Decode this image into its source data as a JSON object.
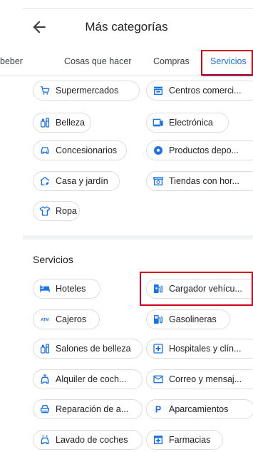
{
  "header": {
    "title": "Más categorías"
  },
  "tabs": [
    {
      "label": "beber"
    },
    {
      "label": "Cosas que hacer"
    },
    {
      "label": "Compras"
    },
    {
      "label": "Servicios"
    }
  ],
  "shopping": {
    "chips": [
      {
        "label": "Supermercados",
        "icon": "cart-icon"
      },
      {
        "label": "Centros comerci...",
        "icon": "store-icon"
      },
      {
        "label": "Belleza",
        "icon": "beauty-icon"
      },
      {
        "label": "Electrónica",
        "icon": "electronics-icon"
      },
      {
        "label": "Concesionarios",
        "icon": "car-icon"
      },
      {
        "label": "Productos depo...",
        "icon": "soccer-ball-icon"
      },
      {
        "label": "Casa y jardín",
        "icon": "home-garden-icon"
      },
      {
        "label": "Tiendas con hor...",
        "icon": "clock-store-icon"
      },
      {
        "label": "Ropa",
        "icon": "shirt-icon"
      }
    ]
  },
  "services": {
    "title": "Servicios",
    "chips": [
      {
        "label": "Hoteles",
        "icon": "bed-icon"
      },
      {
        "label": "Cargador vehícu...",
        "icon": "ev-charger-icon"
      },
      {
        "label": "Cajeros",
        "icon": "atm-icon"
      },
      {
        "label": "Gasolineras",
        "icon": "gas-station-icon"
      },
      {
        "label": "Salones de belleza",
        "icon": "beauty-icon"
      },
      {
        "label": "Hospitales y clín...",
        "icon": "hospital-icon"
      },
      {
        "label": "Alquiler de coch...",
        "icon": "car-rental-icon"
      },
      {
        "label": "Correo y mensaj...",
        "icon": "mail-icon"
      },
      {
        "label": "Reparación de a...",
        "icon": "car-repair-icon"
      },
      {
        "label": "Aparcamientos",
        "icon": "parking-icon"
      },
      {
        "label": "Lavado de coches",
        "icon": "car-wash-icon"
      },
      {
        "label": "Farmacias",
        "icon": "pharmacy-icon"
      }
    ]
  },
  "colors": {
    "accent": "#1a73e8",
    "highlight": "#d0021b",
    "chip_border": "#dadce0"
  }
}
